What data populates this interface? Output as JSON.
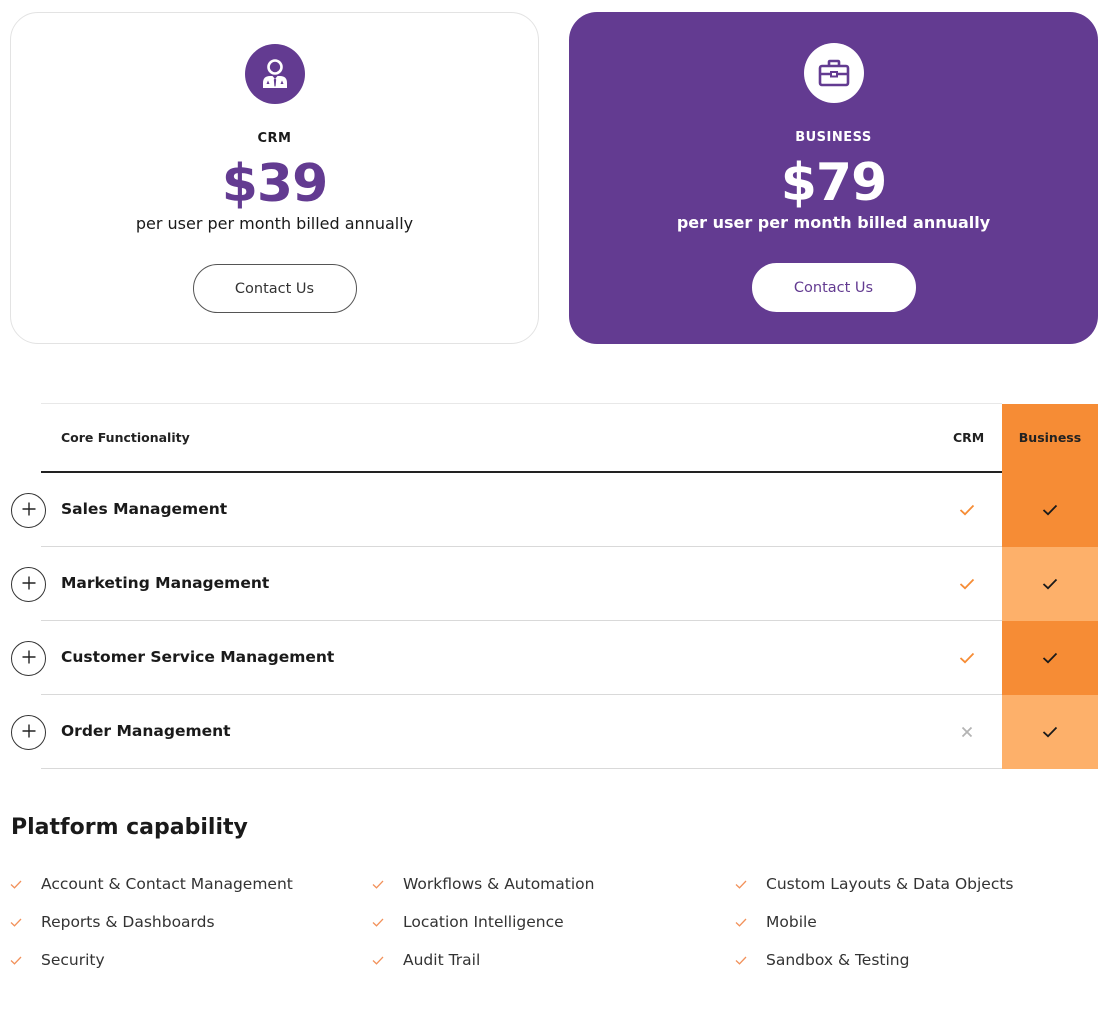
{
  "colors": {
    "brand_purple": "#633b91",
    "accent_orange": "#f68c35",
    "accent_orange_light": "#fdb06a",
    "muted_cross": "#b4b4b4"
  },
  "plans": [
    {
      "icon": "user-tie-icon",
      "name": "CRM",
      "price": "$39",
      "billing": "per user per month billed annually",
      "cta": "Contact Us"
    },
    {
      "icon": "briefcase-icon",
      "name": "BUSINESS",
      "price": "$79",
      "billing": "per user per month billed annually",
      "cta": "Contact Us"
    }
  ],
  "comparison": {
    "headers": {
      "feature": "Core Functionality",
      "crm": "CRM",
      "business": "Business"
    },
    "rows": [
      {
        "label": "Sales Management",
        "crm": "check",
        "business": "check",
        "toggle_icon": "plus-icon"
      },
      {
        "label": "Marketing Management",
        "crm": "check",
        "business": "check",
        "toggle_icon": "plus-icon"
      },
      {
        "label": "Customer Service Management",
        "crm": "check",
        "business": "check",
        "toggle_icon": "plus-icon"
      },
      {
        "label": "Order Management",
        "crm": "cross",
        "business": "check",
        "toggle_icon": "plus-icon"
      }
    ]
  },
  "platform": {
    "title": "Platform capability",
    "columns": [
      [
        "Account & Contact Management",
        "Reports & Dashboards",
        "Security"
      ],
      [
        "Workflows & Automation",
        "Location Intelligence",
        "Audit Trail"
      ],
      [
        "Custom Layouts & Data Objects",
        "Mobile",
        "Sandbox & Testing"
      ]
    ]
  }
}
